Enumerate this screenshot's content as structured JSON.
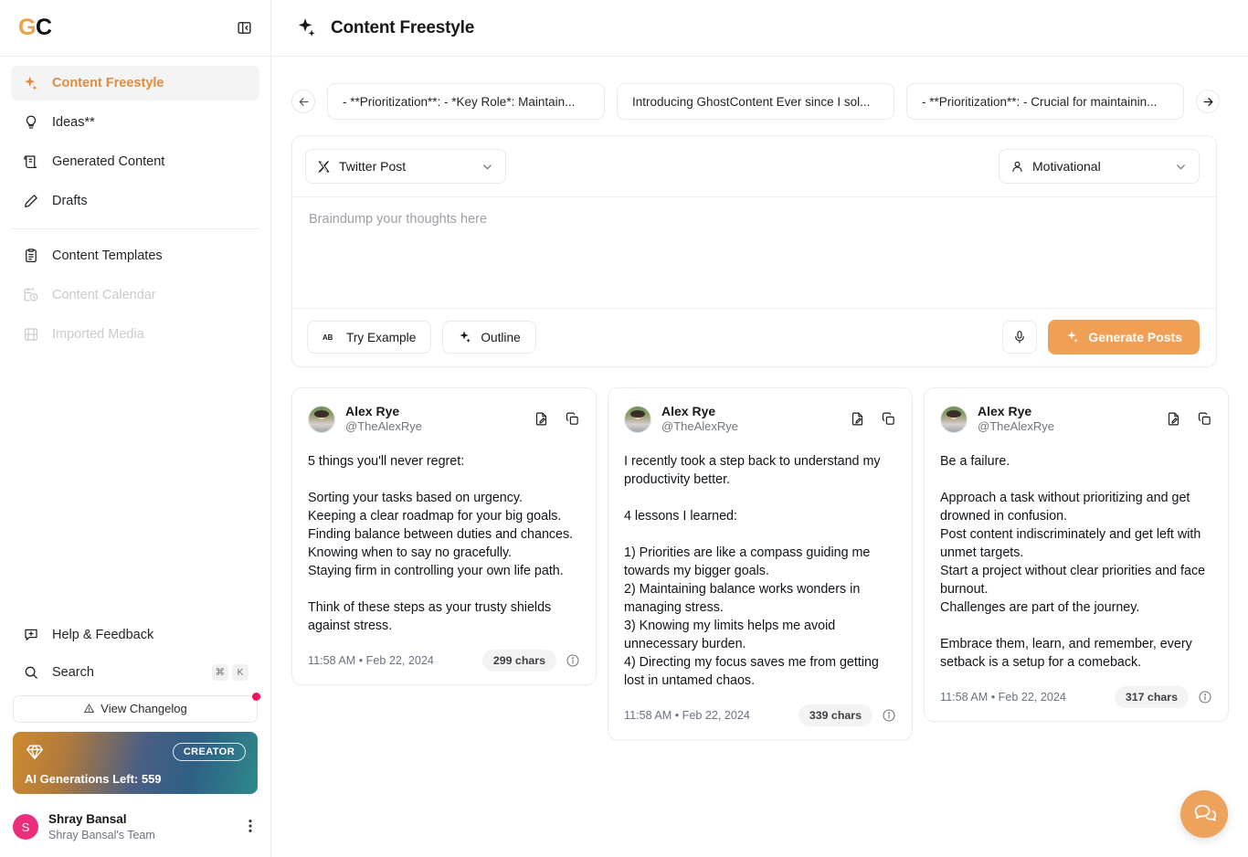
{
  "sidebar": {
    "logo": {
      "first": "G",
      "second": "C"
    },
    "collapse_icon": "panel-collapse-icon",
    "nav_primary": [
      {
        "label": "Content Freestyle",
        "icon": "sparkles-icon",
        "active": true
      },
      {
        "label": "Ideas**",
        "icon": "lightbulb-icon",
        "active": false
      },
      {
        "label": "Generated Content",
        "icon": "scroll-icon",
        "active": false
      },
      {
        "label": "Drafts",
        "icon": "pencil-icon",
        "active": false
      }
    ],
    "nav_secondary": [
      {
        "label": "Content Templates",
        "icon": "clipboard-icon",
        "disabled": false
      },
      {
        "label": "Content Calendar",
        "icon": "calendar-clock-icon",
        "disabled": true
      },
      {
        "label": "Imported Media",
        "icon": "film-icon",
        "disabled": true
      }
    ],
    "help_label": "Help & Feedback",
    "search_label": "Search",
    "search_shortcut": [
      "⌘",
      "K"
    ],
    "changelog_label": "View Changelog",
    "plan": {
      "badge": "CREATOR",
      "generations_label": "AI Generations Left: 559",
      "diamond_icon": "diamond-icon"
    },
    "user": {
      "initial": "S",
      "name": "Shray Bansal",
      "team": "Shray Bansal's Team",
      "menu_icon": "more-vertical-icon"
    }
  },
  "header": {
    "icon": "sparkles-icon",
    "title": "Content Freestyle"
  },
  "tabs": {
    "prev_icon": "arrow-left-icon",
    "next_icon": "arrow-right-icon",
    "items": [
      {
        "label": "- **Prioritization**: - *Key Role*: Maintain..."
      },
      {
        "label": "Introducing GhostContent Ever since I sol..."
      },
      {
        "label": "- **Prioritization**: - Crucial for maintainin..."
      }
    ]
  },
  "composer": {
    "platform": {
      "icon": "x-twitter-icon",
      "value": "Twitter Post"
    },
    "tone": {
      "icon": "person-icon",
      "value": "Motivational"
    },
    "textarea_placeholder": "Braindump your thoughts here",
    "textarea_value": "",
    "try_example": {
      "label": "Try Example",
      "icon": "ab-icon"
    },
    "outline": {
      "label": "Outline",
      "icon": "sparkles-icon"
    },
    "mic_icon": "microphone-icon",
    "generate": {
      "label": "Generate Posts",
      "icon": "sparkles-icon"
    }
  },
  "posts": [
    {
      "name": "Alex Rye",
      "handle": "@TheAlexRye",
      "body": "5 things you'll never regret:\n\nSorting your tasks based on urgency.\nKeeping a clear roadmap for your big goals.\nFinding balance between duties and chances.\nKnowing when to say no gracefully.\nStaying firm in controlling your own life path.\n\nThink of these steps as your trusty shields against stress.",
      "time": "11:58 AM • Feb 22, 2024",
      "chars": "299 chars",
      "edit_icon": "edit-document-icon",
      "copy_icon": "copy-icon",
      "info_icon": "info-circle-icon"
    },
    {
      "name": "Alex Rye",
      "handle": "@TheAlexRye",
      "body": "I recently took a step back to understand my productivity better.\n\n4 lessons I learned:\n\n1) Priorities are like a compass guiding me towards my bigger goals.\n2) Maintaining balance works wonders in managing stress.\n3) Knowing my limits helps me avoid unnecessary burden.\n4) Directing my focus saves me from getting lost in untamed chaos.",
      "time": "11:58 AM • Feb 22, 2024",
      "chars": "339 chars",
      "edit_icon": "edit-document-icon",
      "copy_icon": "copy-icon",
      "info_icon": "info-circle-icon"
    },
    {
      "name": "Alex Rye",
      "handle": "@TheAlexRye",
      "body": "Be a failure.\n\nApproach a task without prioritizing and get drowned in confusion.\nPost content indiscriminately and get left with unmet targets.\nStart a project without clear priorities and face burnout.\nChallenges are part of the journey.\n\nEmbrace them, learn, and remember, every setback is a setup for a comeback.",
      "time": "11:58 AM • Feb 22, 2024",
      "chars": "317 chars",
      "edit_icon": "edit-document-icon",
      "copy_icon": "copy-icon",
      "info_icon": "info-circle-icon"
    }
  ],
  "chat_fab": {
    "icon": "chat-bubbles-icon"
  },
  "colors": {
    "accent": "#eda14a",
    "primary_button": "#f0a055",
    "active_nav_text": "#e08b3e",
    "avatar_pink": "#ea2e7b",
    "notification_dot": "#f31260"
  }
}
